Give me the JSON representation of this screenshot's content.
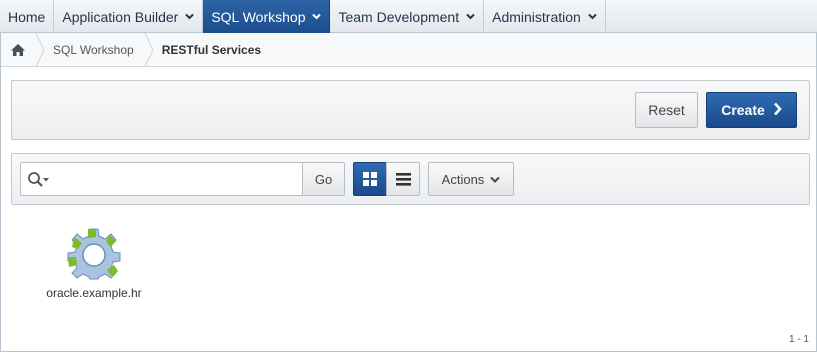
{
  "topnav": {
    "tabs": [
      {
        "label": "Home",
        "has_menu": false,
        "active": false
      },
      {
        "label": "Application Builder",
        "has_menu": true,
        "active": false
      },
      {
        "label": "SQL Workshop",
        "has_menu": true,
        "active": true
      },
      {
        "label": "Team Development",
        "has_menu": true,
        "active": false
      },
      {
        "label": "Administration",
        "has_menu": true,
        "active": false
      }
    ]
  },
  "breadcrumb": {
    "home_icon": "home-icon",
    "items": [
      {
        "label": "SQL Workshop",
        "current": false
      },
      {
        "label": "RESTful Services",
        "current": true
      }
    ]
  },
  "buttons_region": {
    "reset_label": "Reset",
    "create_label": "Create",
    "create_icon": "chevron-right-icon"
  },
  "search_region": {
    "search_icon": "search-icon",
    "search_value": "",
    "go_label": "Go",
    "view_icons": [
      "grid-view-icon",
      "list-view-icon"
    ],
    "active_view": "grid",
    "actions_label": "Actions"
  },
  "results": {
    "items": [
      {
        "label": "oracle.example.hr",
        "icon": "gear-module-icon"
      }
    ],
    "pagination": "1 - 1"
  },
  "colors": {
    "accent": "#1c4d8c",
    "nav_bg": "#e3e8ee",
    "gear_green": "#7dbb2a",
    "gear_blue": "#a9c3e0"
  }
}
